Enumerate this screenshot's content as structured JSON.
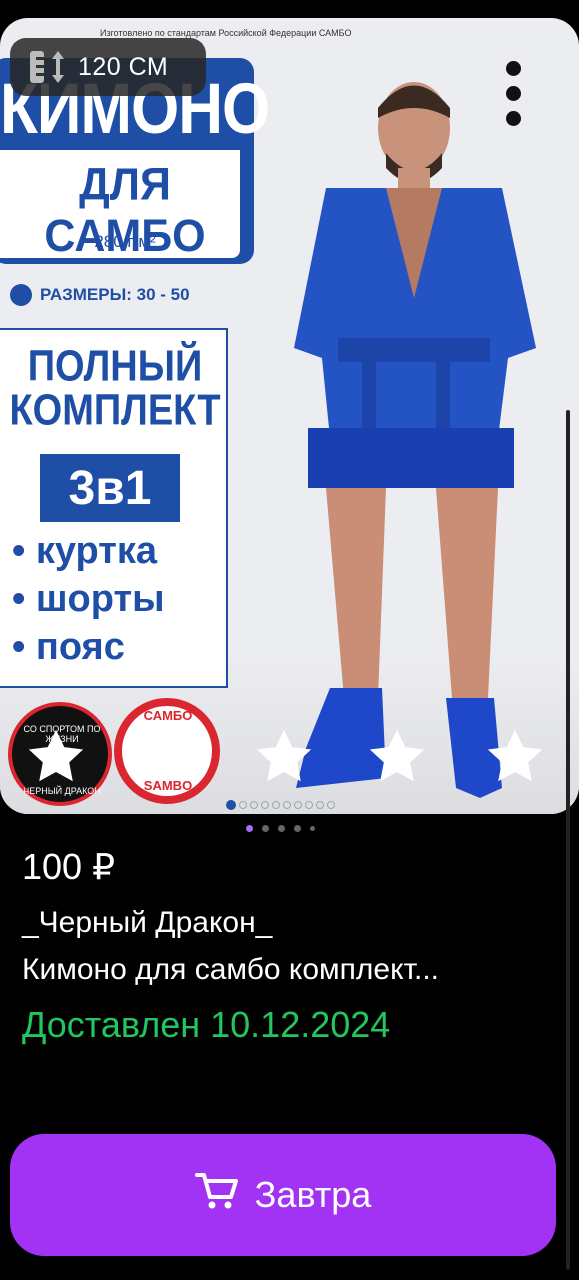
{
  "product_image": {
    "top_caption": "Изготовлено по стандартам Российской Федерации САМБО",
    "height_badge": "120 СМ",
    "title_word": "КИМОНО",
    "title_sub": "ДЛЯ САМБО",
    "weight": "280 г/м²",
    "sizes": "РАЗМЕРЫ: 30 - 50",
    "kit_line1": "ПОЛНЫЙ",
    "kit_line2": "КОМПЛЕКТ",
    "kit_badge": "3в1",
    "kit_items": [
      "• куртка",
      "• шорты",
      "• пояс"
    ],
    "logo1_top": "СО СПОРТОМ ПО ЖИЗНИ",
    "logo1_bottom": "ЧЕРНЫЙ ДРАКОН",
    "logo2_top": "САМБО",
    "logo2_bottom": "SAMBO",
    "image_count": 10,
    "active_image": 1
  },
  "rating": {
    "stars": 5
  },
  "pager": {
    "count": 5,
    "active": 1
  },
  "product": {
    "price": "100 ₽",
    "seller": "_Черный Дракон_",
    "name": "Кимоно для самбо комплект...",
    "delivery_status": "Доставлен 10.12.2024"
  },
  "cta": {
    "label": "Завтра"
  },
  "colors": {
    "accent": "#a233f4",
    "delivered": "#22c55e",
    "brand_blue": "#1f4ea6",
    "pager_active": "#a96af5"
  }
}
